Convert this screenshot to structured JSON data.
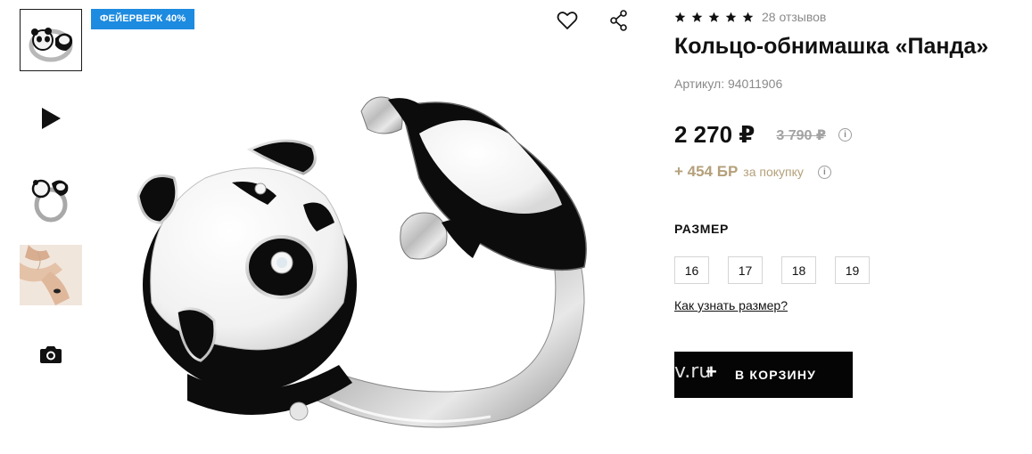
{
  "badge": "ФЕЙЕРВЕРК 40%",
  "gallery": {
    "thumbs": [
      {
        "name": "ring-top-view",
        "icon": "thumbnail-image"
      },
      {
        "name": "video",
        "icon": "play-icon"
      },
      {
        "name": "ring-side-view",
        "icon": "thumbnail-image"
      },
      {
        "name": "model-wearing",
        "icon": "thumbnail-image"
      },
      {
        "name": "photos",
        "icon": "camera-icon"
      }
    ]
  },
  "product": {
    "reviews": "28 отзывов",
    "rating": 5,
    "title": "Кольцо-обнимашка «Панда»",
    "sku_label": "Артикул:",
    "sku": "94011906",
    "price": "2 270 ₽",
    "old_price": "3 790 ₽",
    "bonus": "+ 454 БР",
    "bonus_label": "за покупку",
    "size_label": "РАЗМЕР",
    "sizes": [
      "16",
      "17",
      "18",
      "19"
    ],
    "size_link": "Как узнать размер?",
    "cart_ghost": "v.ru",
    "cart_plus": "+",
    "cart_label": "В КОРЗИНУ"
  },
  "colors": {
    "badge": "#1d8be0",
    "bonus": "#b4a07a",
    "cart_button": "#050505"
  }
}
